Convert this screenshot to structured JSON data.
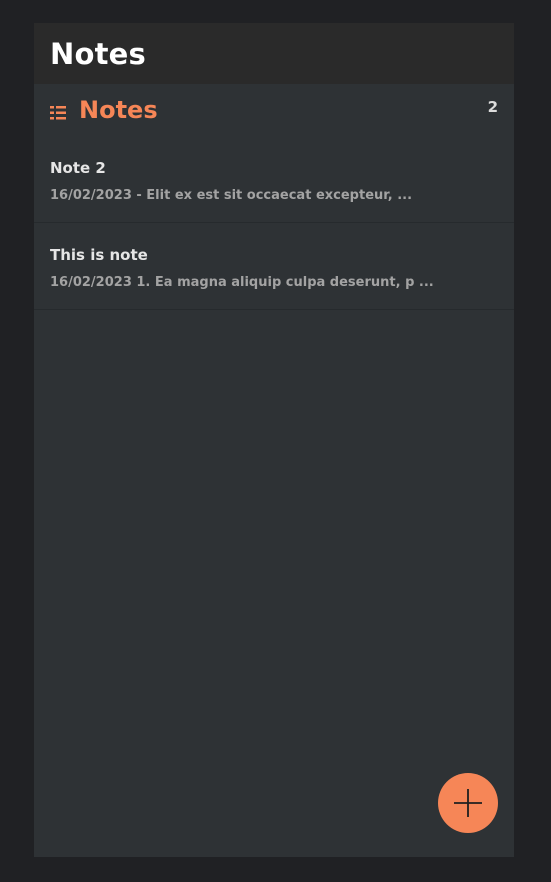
{
  "app": {
    "title": "Notes"
  },
  "section": {
    "icon": "list-icon",
    "title": "Notes",
    "count": "2"
  },
  "notes": [
    {
      "title": "Note 2",
      "meta": "16/02/2023 - Elit ex est sit occaecat excepteur, ..."
    },
    {
      "title": "This is note",
      "meta": "16/02/2023 1. Ea magna aliquip culpa deserunt, p ..."
    }
  ],
  "fab": {
    "icon": "plus-icon"
  },
  "colors": {
    "accent": "#f68657",
    "background": "#202124",
    "panel": "#2e3235",
    "header": "#2a2a2a"
  }
}
